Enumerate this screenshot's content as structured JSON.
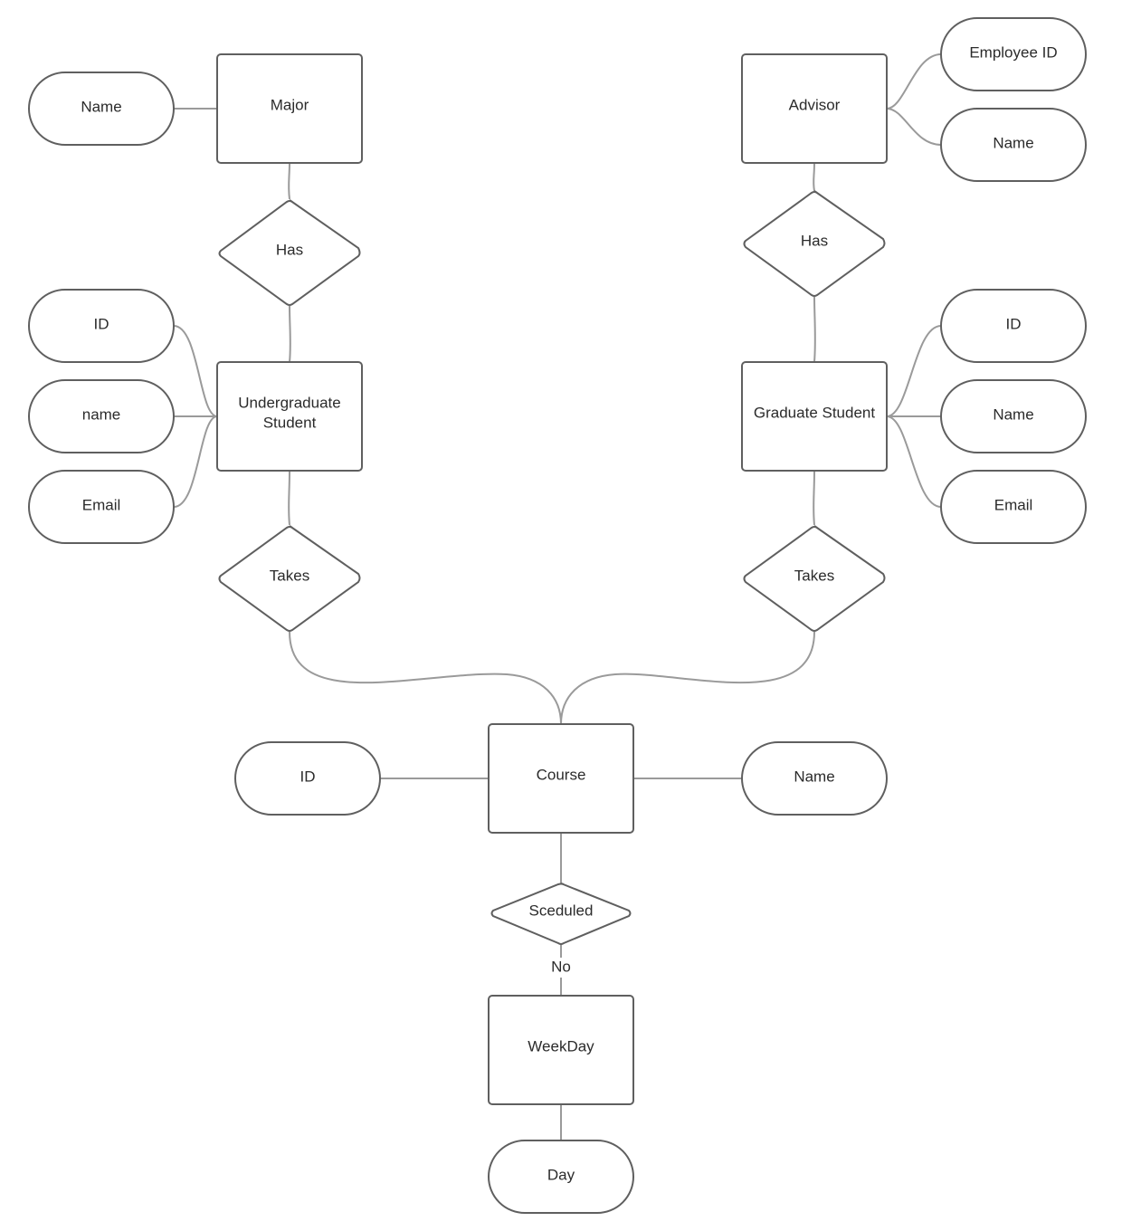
{
  "diagram": {
    "type": "entity-relationship",
    "entities": [
      {
        "id": "major",
        "label": "Major"
      },
      {
        "id": "advisor",
        "label": "Advisor"
      },
      {
        "id": "undergrad",
        "label": "Undergraduate Student",
        "lines": [
          "Undergraduate",
          "Student"
        ]
      },
      {
        "id": "grad",
        "label": "Graduate Student"
      },
      {
        "id": "course",
        "label": "Course"
      },
      {
        "id": "weekday",
        "label": "WeekDay"
      }
    ],
    "relationships": [
      {
        "id": "has_major",
        "label": "Has"
      },
      {
        "id": "has_advisor",
        "label": "Has"
      },
      {
        "id": "takes_ug",
        "label": "Takes"
      },
      {
        "id": "takes_grad",
        "label": "Takes"
      },
      {
        "id": "sceduled",
        "label": "Sceduled"
      }
    ],
    "attributes": [
      {
        "id": "major_name",
        "label": "Name",
        "of": "major"
      },
      {
        "id": "adv_empid",
        "label": "Employee ID",
        "of": "advisor"
      },
      {
        "id": "adv_name",
        "label": "Name",
        "of": "advisor"
      },
      {
        "id": "ug_id",
        "label": "ID",
        "of": "undergrad"
      },
      {
        "id": "ug_name",
        "label": "name",
        "of": "undergrad"
      },
      {
        "id": "ug_email",
        "label": "Email",
        "of": "undergrad"
      },
      {
        "id": "gr_id",
        "label": "ID",
        "of": "grad"
      },
      {
        "id": "gr_name",
        "label": "Name",
        "of": "grad"
      },
      {
        "id": "gr_email",
        "label": "Email",
        "of": "grad"
      },
      {
        "id": "course_id",
        "label": "ID",
        "of": "course"
      },
      {
        "id": "course_name",
        "label": "Name",
        "of": "course"
      },
      {
        "id": "weekday_day",
        "label": "Day",
        "of": "weekday"
      }
    ],
    "edges": [
      {
        "from": "major_name",
        "to": "major"
      },
      {
        "from": "major",
        "to": "has_major"
      },
      {
        "from": "has_major",
        "to": "undergrad"
      },
      {
        "from": "advisor",
        "to": "adv_empid"
      },
      {
        "from": "advisor",
        "to": "adv_name"
      },
      {
        "from": "advisor",
        "to": "has_advisor"
      },
      {
        "from": "has_advisor",
        "to": "grad"
      },
      {
        "from": "ug_id",
        "to": "undergrad"
      },
      {
        "from": "ug_name",
        "to": "undergrad"
      },
      {
        "from": "ug_email",
        "to": "undergrad"
      },
      {
        "from": "grad",
        "to": "gr_id"
      },
      {
        "from": "grad",
        "to": "gr_name"
      },
      {
        "from": "grad",
        "to": "gr_email"
      },
      {
        "from": "undergrad",
        "to": "takes_ug"
      },
      {
        "from": "grad",
        "to": "takes_grad"
      },
      {
        "from": "takes_ug",
        "to": "course"
      },
      {
        "from": "takes_grad",
        "to": "course"
      },
      {
        "from": "course_id",
        "to": "course"
      },
      {
        "from": "course",
        "to": "course_name"
      },
      {
        "from": "course",
        "to": "sceduled"
      },
      {
        "from": "sceduled",
        "to": "weekday",
        "label": "No"
      },
      {
        "from": "weekday",
        "to": "weekday_day"
      }
    ],
    "colors": {
      "shape_stroke": "#5f5f5f",
      "connector": "#9a9a9a",
      "text": "#2b2b2b",
      "background": "#ffffff"
    }
  }
}
